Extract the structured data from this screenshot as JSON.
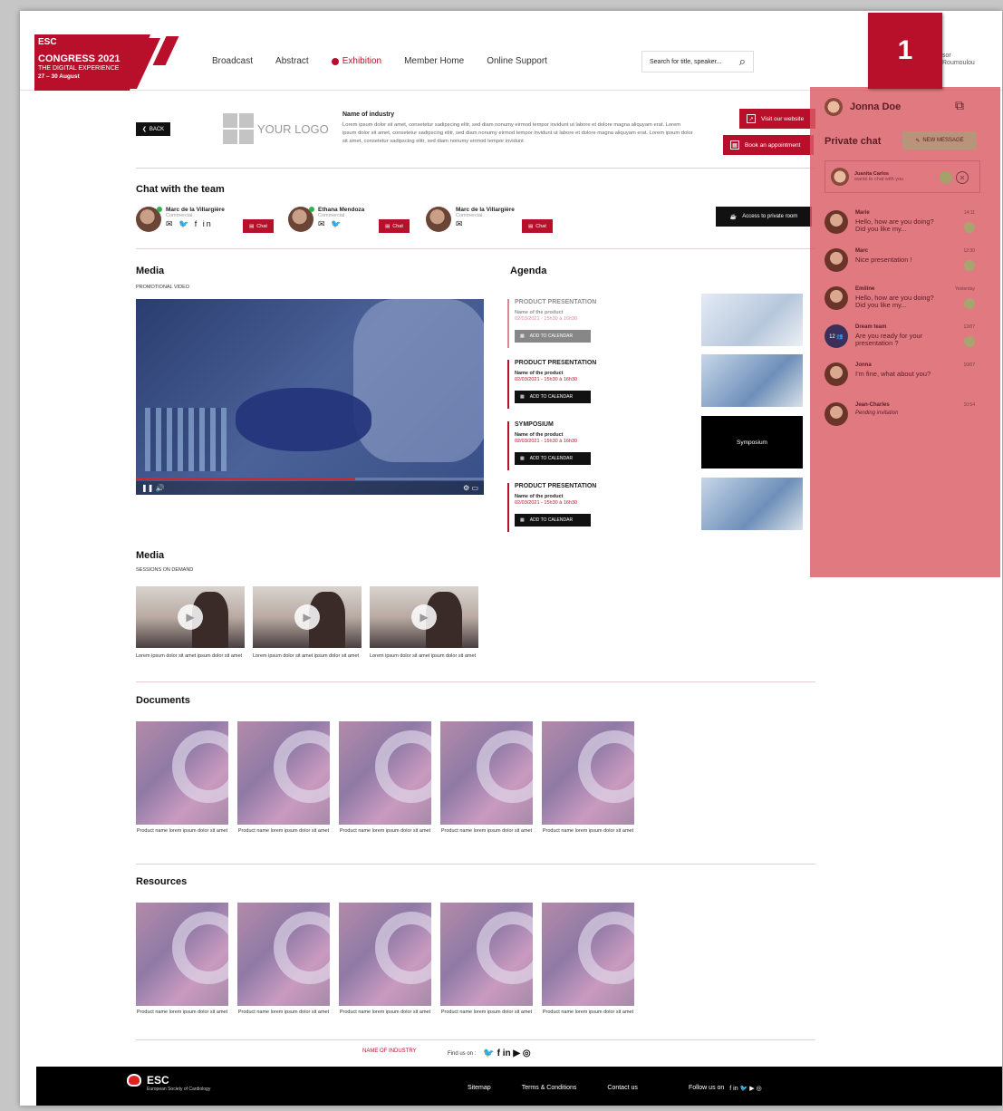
{
  "header": {
    "logo": {
      "line1": "ESC",
      "line2": "CONGRESS 2021",
      "line3": "THE DIGITAL EXPERIENCE",
      "line4": "27 – 30 August"
    },
    "nav": [
      "Broadcast",
      "Abstract",
      "Exhibition",
      "Member Home",
      "Online Support"
    ],
    "active_nav": "Exhibition",
    "search_placeholder": "Search for title, speaker...",
    "user_name_fragment": "sor\nRoumoulou",
    "callout_badge": "1"
  },
  "industry": {
    "back_label": "BACK",
    "logo_text": "YOUR LOGO",
    "name": "Name of industry",
    "description": "Lorem ipsum dolor sit amet, consetetur sadipscing elitr, sed diam nonumy eirmod tempor invidunt ut labore et dolore magna aliquyam erat. Lorem ipsum dolor sit amet, consetetur sadipscing elitr, sed diam nonumy eirmod tempor invidunt ut labore et dolore magna aliquyam erat. Lorem ipsum dolor sit amet, consetetur sadipscing elitr, sed diam nonumy eirmod tempor invidunt",
    "visit_label": "Visit our website",
    "book_label": "Book an appointment"
  },
  "team": {
    "title": "Chat with the team",
    "members": [
      {
        "name": "Marc de la Villargière",
        "role": "Commercial",
        "social": "✉ 🐦 f in",
        "chat": "Chat"
      },
      {
        "name": "Ethana Mendoza",
        "role": "Commercial",
        "social": "✉ 🐦",
        "chat": "Chat"
      },
      {
        "name": "Marc de la Villargière",
        "role": "Commercial",
        "social": "✉",
        "chat": "Chat"
      }
    ],
    "private_room": "Access to private room"
  },
  "media": {
    "title": "Media",
    "subtitle": "PROMOTIONAL VIDEO",
    "progress": 0.63
  },
  "agenda": {
    "title": "Agenda",
    "items": [
      {
        "title": "PRODUCT PRESENTATION",
        "name": "Name of the product",
        "date": "02/03/2021 - 15h30 à 16h30",
        "cta": "ADD TO CALENDAR",
        "media": ""
      },
      {
        "title": "PRODUCT PRESENTATION",
        "name": "Name of the product",
        "date": "02/03/2021 - 15h30 à 16h30",
        "cta": "ADD TO CALENDAR",
        "media": ""
      },
      {
        "title": "SYMPOSIUM",
        "name": "Name of the product",
        "date": "02/03/2021 - 15h30 à 16h30",
        "cta": "ADD TO CALENDAR",
        "media": "Symposium"
      },
      {
        "title": "PRODUCT PRESENTATION",
        "name": "Name of the product",
        "date": "02/03/2021 - 15h30 à 16h30",
        "cta": "ADD TO CALENDAR",
        "media": ""
      }
    ]
  },
  "sessions": {
    "title": "Media",
    "subtitle": "SESSIONS ON DEMAND",
    "items": [
      {
        "caption": "Lorem ipsum dolor sit amet ipsum dolor sit amet"
      },
      {
        "caption": "Lorem ipsum dolor sit amet ipsum dolor sit amet"
      },
      {
        "caption": "Lorem ipsum dolor sit amet ipsum dolor sit amet"
      }
    ]
  },
  "documents": {
    "title": "Documents",
    "items": [
      "Product name lorem ipsum dolor sit amet",
      "Product name lorem ipsum dolor sit amet",
      "Product name lorem ipsum dolor sit amet",
      "Product name lorem ipsum dolor sit amet",
      "Product name lorem ipsum dolor sit amet"
    ]
  },
  "resources": {
    "title": "Resources",
    "items": [
      "Product name lorem ipsum dolor sit amet",
      "Product name lorem ipsum dolor sit amet",
      "Product name lorem ipsum dolor sit amet",
      "Product name lorem ipsum dolor sit amet",
      "Product name lorem ipsum dolor sit amet"
    ]
  },
  "page_footer": {
    "industry": "NAME OF INDUSTRY",
    "find_us": "Find us on :",
    "socials": "🐦 f in ▶ ◎"
  },
  "site_footer": {
    "brand": "ESC",
    "brand_sub": "European Society of Cardiology",
    "links": [
      "Sitemap",
      "Terms & Conditions",
      "Contact us"
    ],
    "follow": "Follow us on",
    "socials": "f in 🐦 ▶ ◎"
  },
  "sidebar": {
    "user": "Jonna Doe",
    "private_chat": "Private chat",
    "new_message": "NEW MESSAGE",
    "invite": {
      "name": "Juanita Carlos",
      "text": "wants to chat with you"
    },
    "conversations": [
      {
        "name": "Marie",
        "message": "Hello, how are you doing? Did you like my...",
        "time": "14:11",
        "team": false
      },
      {
        "name": "Marc",
        "message": "Nice presentation !",
        "time": "12:30",
        "team": false
      },
      {
        "name": "Emiline",
        "message": "Hello, how are you doing? Did you like my...",
        "time": "Yesterday",
        "team": false
      },
      {
        "name": "Dream team",
        "message": "Are you ready for your presentation ?",
        "time": "12/07",
        "team": true
      },
      {
        "name": "Jonna",
        "message": "I'm fine, what about you?",
        "time": "10/07",
        "team": false
      },
      {
        "name": "Jean-Charles",
        "message": "Pending invitation",
        "time": "10:54",
        "team": false
      }
    ]
  },
  "colors": {
    "brand": "#b8102a",
    "overlay": "#db5b65"
  }
}
